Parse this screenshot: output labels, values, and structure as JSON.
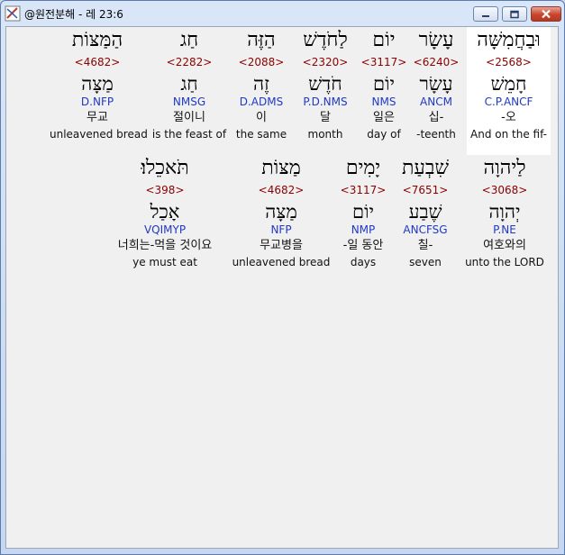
{
  "window": {
    "title": "@원전분해 - 레 23:6"
  },
  "rows": [
    [
      {
        "heb": "וּבַחֲמִשָּׁה",
        "strong": "<2568>",
        "lemma": "חָמֵשׁ",
        "morph": "C.P.ANCF",
        "kor": "-오",
        "eng": "And on the fif-"
      },
      {
        "heb": "עָשָׂר",
        "strong": "<6240>",
        "lemma": "עָשָׂר",
        "morph": "ANCM",
        "kor": "십-",
        "eng": "-teenth"
      },
      {
        "heb": "יוֹם",
        "strong": "<3117>",
        "lemma": "יוֹם",
        "morph": "NMS",
        "kor": "일은",
        "eng": "day of"
      },
      {
        "heb": "לַחֹדֶשׁ",
        "strong": "<2320>",
        "lemma": "חֹדֶשׁ",
        "morph": "P.D.NMS",
        "kor": "달",
        "eng": "month"
      },
      {
        "heb": "הַזֶּה",
        "strong": "<2088>",
        "lemma": "זֶה",
        "morph": "D.ADMS",
        "kor": "이",
        "eng": "the same"
      },
      {
        "heb": "חַג",
        "strong": "<2282>",
        "lemma": "חַג",
        "morph": "NMSG",
        "kor": "절이니",
        "eng": "is the feast of"
      },
      {
        "heb": "הַמַּצּוֹת",
        "strong": "<4682>",
        "lemma": "מַצָּה",
        "morph": "D.NFP",
        "kor": "무교",
        "eng": "unleavened bread"
      }
    ],
    [
      {
        "heb": "לַיהוָה",
        "strong": "<3068>",
        "lemma": "יְהוָה",
        "morph": "P.NE",
        "kor": "여호와의",
        "eng": "unto the LORD"
      },
      {
        "heb": "שִׁבְעַת",
        "strong": "<7651>",
        "lemma": "שֶׁבַע",
        "morph": "ANCFSG",
        "kor": "칠-",
        "eng": "seven"
      },
      {
        "heb": "יָמִים",
        "strong": "<3117>",
        "lemma": "יוֹם",
        "morph": "NMP",
        "kor": "-일 동안",
        "eng": "days"
      },
      {
        "heb": "מַצּוֹת",
        "strong": "<4682>",
        "lemma": "מַצָּה",
        "morph": "NFP",
        "kor": "무교병을",
        "eng": "unleavened bread"
      },
      {
        "heb": "תֹּאכֵלוּ׃",
        "strong": "<398>",
        "lemma": "אָכַל",
        "morph": "VQIMYP",
        "kor": "너희는-먹을 것이요",
        "eng": "ye must eat"
      }
    ]
  ]
}
